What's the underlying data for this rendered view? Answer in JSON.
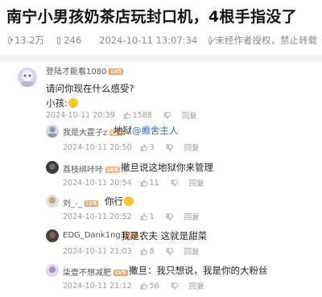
{
  "post": {
    "title": "南宁小男孩奶茶店玩封口机，4根手指没了",
    "views": "13.2万",
    "comments": "246",
    "datetime": "2024-10-11 13:07:34",
    "license": "未经作者授权，禁止转载"
  },
  "comments": [
    {
      "user": "登陆才能看1080",
      "level": "LV5",
      "lines": [
        "请问你现在什么感受?",
        "小孩:"
      ],
      "time": "2024-10-11 20:39",
      "likes": "1588",
      "reply": "回复"
    },
    {
      "user": "我是大霆子z",
      "level": "LV4",
      "text": "地狱",
      "mention": "@癫舍主人",
      "time": "2024-10-11 20:50",
      "likes": "3",
      "reply": "回复"
    },
    {
      "user": "荔枝绑咔咔",
      "level": "LV4",
      "text": "撤旦说这地狱你来管理",
      "time": "2024-10-11 20:54",
      "likes": "11",
      "reply": "回复"
    },
    {
      "user": "刘_-_",
      "level": "LV6",
      "text": "你行",
      "time": "2024-10-11 20:52",
      "likes": "1",
      "reply": "回复"
    },
    {
      "user": "EDG_Dank1ng",
      "level": "LV6",
      "text": "我是农夫 这就是甜菜",
      "time": "2024-10-11 21:03",
      "likes": "8",
      "reply": "回复"
    },
    {
      "user": "柒壹不想减肥",
      "level": "LV5",
      "text": "撒旦：我只想说，我是你的大粉丝",
      "time": "2024-10-11 21:12",
      "likes": "56",
      "reply": "回复"
    }
  ]
}
